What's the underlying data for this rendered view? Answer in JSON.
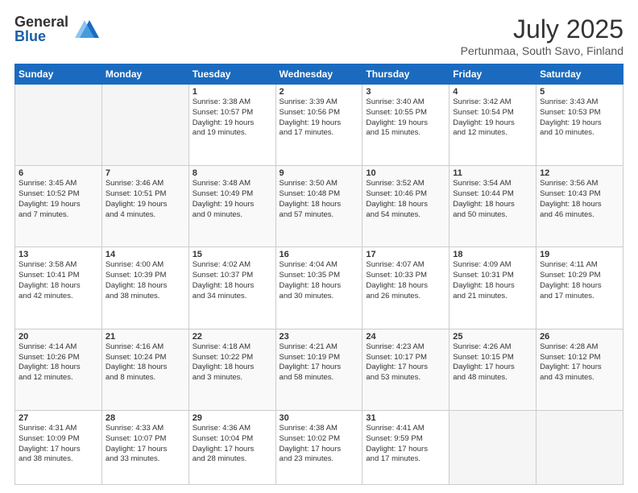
{
  "header": {
    "logo_general": "General",
    "logo_blue": "Blue",
    "month_title": "July 2025",
    "location": "Pertunmaa, South Savo, Finland"
  },
  "weekdays": [
    "Sunday",
    "Monday",
    "Tuesday",
    "Wednesday",
    "Thursday",
    "Friday",
    "Saturday"
  ],
  "weeks": [
    [
      {
        "day": "",
        "info": ""
      },
      {
        "day": "",
        "info": ""
      },
      {
        "day": "1",
        "info": "Sunrise: 3:38 AM\nSunset: 10:57 PM\nDaylight: 19 hours\nand 19 minutes."
      },
      {
        "day": "2",
        "info": "Sunrise: 3:39 AM\nSunset: 10:56 PM\nDaylight: 19 hours\nand 17 minutes."
      },
      {
        "day": "3",
        "info": "Sunrise: 3:40 AM\nSunset: 10:55 PM\nDaylight: 19 hours\nand 15 minutes."
      },
      {
        "day": "4",
        "info": "Sunrise: 3:42 AM\nSunset: 10:54 PM\nDaylight: 19 hours\nand 12 minutes."
      },
      {
        "day": "5",
        "info": "Sunrise: 3:43 AM\nSunset: 10:53 PM\nDaylight: 19 hours\nand 10 minutes."
      }
    ],
    [
      {
        "day": "6",
        "info": "Sunrise: 3:45 AM\nSunset: 10:52 PM\nDaylight: 19 hours\nand 7 minutes."
      },
      {
        "day": "7",
        "info": "Sunrise: 3:46 AM\nSunset: 10:51 PM\nDaylight: 19 hours\nand 4 minutes."
      },
      {
        "day": "8",
        "info": "Sunrise: 3:48 AM\nSunset: 10:49 PM\nDaylight: 19 hours\nand 0 minutes."
      },
      {
        "day": "9",
        "info": "Sunrise: 3:50 AM\nSunset: 10:48 PM\nDaylight: 18 hours\nand 57 minutes."
      },
      {
        "day": "10",
        "info": "Sunrise: 3:52 AM\nSunset: 10:46 PM\nDaylight: 18 hours\nand 54 minutes."
      },
      {
        "day": "11",
        "info": "Sunrise: 3:54 AM\nSunset: 10:44 PM\nDaylight: 18 hours\nand 50 minutes."
      },
      {
        "day": "12",
        "info": "Sunrise: 3:56 AM\nSunset: 10:43 PM\nDaylight: 18 hours\nand 46 minutes."
      }
    ],
    [
      {
        "day": "13",
        "info": "Sunrise: 3:58 AM\nSunset: 10:41 PM\nDaylight: 18 hours\nand 42 minutes."
      },
      {
        "day": "14",
        "info": "Sunrise: 4:00 AM\nSunset: 10:39 PM\nDaylight: 18 hours\nand 38 minutes."
      },
      {
        "day": "15",
        "info": "Sunrise: 4:02 AM\nSunset: 10:37 PM\nDaylight: 18 hours\nand 34 minutes."
      },
      {
        "day": "16",
        "info": "Sunrise: 4:04 AM\nSunset: 10:35 PM\nDaylight: 18 hours\nand 30 minutes."
      },
      {
        "day": "17",
        "info": "Sunrise: 4:07 AM\nSunset: 10:33 PM\nDaylight: 18 hours\nand 26 minutes."
      },
      {
        "day": "18",
        "info": "Sunrise: 4:09 AM\nSunset: 10:31 PM\nDaylight: 18 hours\nand 21 minutes."
      },
      {
        "day": "19",
        "info": "Sunrise: 4:11 AM\nSunset: 10:29 PM\nDaylight: 18 hours\nand 17 minutes."
      }
    ],
    [
      {
        "day": "20",
        "info": "Sunrise: 4:14 AM\nSunset: 10:26 PM\nDaylight: 18 hours\nand 12 minutes."
      },
      {
        "day": "21",
        "info": "Sunrise: 4:16 AM\nSunset: 10:24 PM\nDaylight: 18 hours\nand 8 minutes."
      },
      {
        "day": "22",
        "info": "Sunrise: 4:18 AM\nSunset: 10:22 PM\nDaylight: 18 hours\nand 3 minutes."
      },
      {
        "day": "23",
        "info": "Sunrise: 4:21 AM\nSunset: 10:19 PM\nDaylight: 17 hours\nand 58 minutes."
      },
      {
        "day": "24",
        "info": "Sunrise: 4:23 AM\nSunset: 10:17 PM\nDaylight: 17 hours\nand 53 minutes."
      },
      {
        "day": "25",
        "info": "Sunrise: 4:26 AM\nSunset: 10:15 PM\nDaylight: 17 hours\nand 48 minutes."
      },
      {
        "day": "26",
        "info": "Sunrise: 4:28 AM\nSunset: 10:12 PM\nDaylight: 17 hours\nand 43 minutes."
      }
    ],
    [
      {
        "day": "27",
        "info": "Sunrise: 4:31 AM\nSunset: 10:09 PM\nDaylight: 17 hours\nand 38 minutes."
      },
      {
        "day": "28",
        "info": "Sunrise: 4:33 AM\nSunset: 10:07 PM\nDaylight: 17 hours\nand 33 minutes."
      },
      {
        "day": "29",
        "info": "Sunrise: 4:36 AM\nSunset: 10:04 PM\nDaylight: 17 hours\nand 28 minutes."
      },
      {
        "day": "30",
        "info": "Sunrise: 4:38 AM\nSunset: 10:02 PM\nDaylight: 17 hours\nand 23 minutes."
      },
      {
        "day": "31",
        "info": "Sunrise: 4:41 AM\nSunset: 9:59 PM\nDaylight: 17 hours\nand 17 minutes."
      },
      {
        "day": "",
        "info": ""
      },
      {
        "day": "",
        "info": ""
      }
    ]
  ]
}
